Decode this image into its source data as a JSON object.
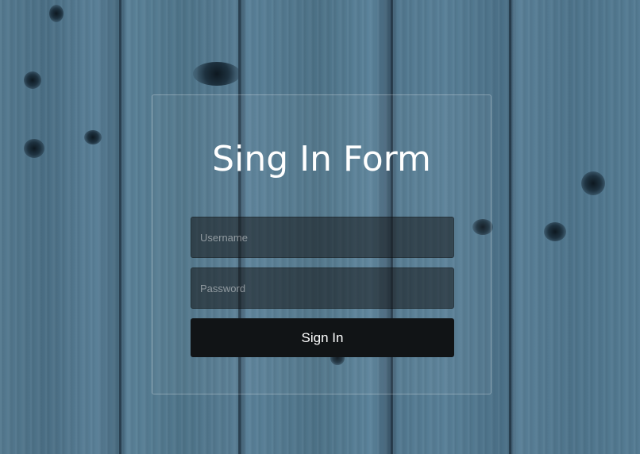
{
  "form": {
    "title": "Sing In Form",
    "username_placeholder": "Username",
    "password_placeholder": "Password",
    "submit_label": "Sign In"
  }
}
